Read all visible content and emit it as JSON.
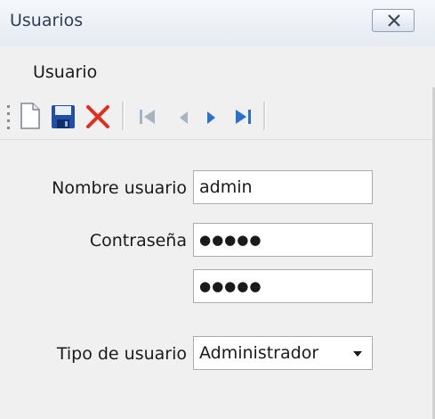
{
  "window": {
    "title": "Usuarios"
  },
  "menu": {
    "items": [
      "Usuario"
    ]
  },
  "toolbar": {
    "icons": [
      "new-document-icon",
      "save-icon",
      "delete-icon",
      "first-record-icon",
      "previous-record-icon",
      "next-record-icon",
      "last-record-icon"
    ]
  },
  "form": {
    "username_label": "Nombre usuario",
    "username_value": "admin",
    "password_label": "Contraseña",
    "password_mask": "●●●●●",
    "confirm_mask": "●●●●●",
    "user_type_label": "Tipo de usuario",
    "user_type_value": "Administrador"
  },
  "colors": {
    "delete": "#e32c1c",
    "save": "#1f4fa8",
    "nav_active": "#2a6fd6",
    "nav_disabled": "#a8b3c2"
  }
}
